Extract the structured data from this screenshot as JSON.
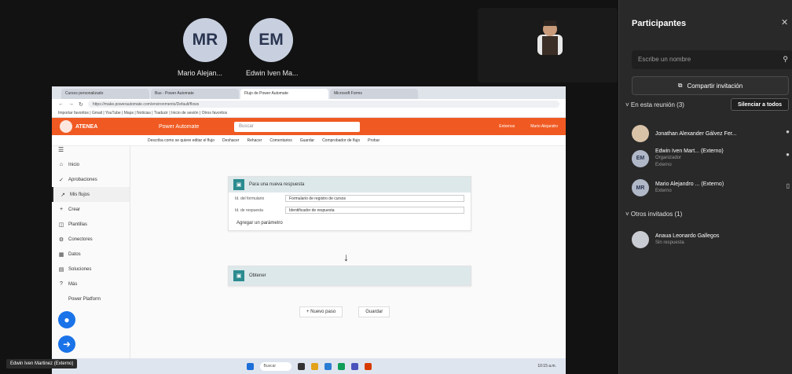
{
  "strip": {
    "tiles": [
      {
        "initials": "MR",
        "name": "Mario Alejan..."
      },
      {
        "initials": "EM",
        "name": "Edwin Iven Ma..."
      }
    ]
  },
  "browser": {
    "tabs": [
      "Cursos personalizado",
      "Bus - Power Automate",
      "Flujo de Power Automate",
      "Microsoft Forms"
    ],
    "url": "https://make.powerautomate.com/environments/Default/flows",
    "bookmarks": "Importar favoritos  |  Gmail  |  YouTube  |  Maps  |  Noticias  |  Traducir  |  Inicio de sesión  |  Otros favoritos"
  },
  "app": {
    "brand": "ATENEA",
    "header_title": "Power Automate",
    "search_placeholder": "Buscar",
    "env_label": "Entornos",
    "user_label": "Mario Alejandro",
    "cmdbar": [
      "Describa como se quiere editar el flujo",
      "Deshacer",
      "Rehacer",
      "Comentarios",
      "Guardar",
      "Comprobador de flujo",
      "Probar"
    ],
    "sidebar": [
      {
        "icon": "⌂",
        "label": "Inicio"
      },
      {
        "icon": "✓",
        "label": "Aprobaciones"
      },
      {
        "icon": "↗",
        "label": "Mis flujos"
      },
      {
        "icon": "+",
        "label": "Crear"
      },
      {
        "icon": "◫",
        "label": "Plantillas"
      },
      {
        "icon": "⚙",
        "label": "Conectores"
      },
      {
        "icon": "▦",
        "label": "Datos"
      },
      {
        "icon": "▤",
        "label": "Soluciones"
      },
      {
        "icon": "?",
        "label": "Más"
      },
      {
        "icon": "",
        "label": "Power Platform"
      }
    ],
    "card1": {
      "title": "Para una nueva respuesta",
      "fields": [
        {
          "label": "Id. del formulario",
          "value": "Formulario de registro de cursos"
        },
        {
          "label": "Id. de respuesta",
          "value": "Identificador de respuesta"
        }
      ],
      "add_param": "Agregar un parámetro"
    },
    "card2": {
      "title": "Obtener"
    },
    "buttons": {
      "new_step": "+ Nuevo paso",
      "save": "Guardar"
    },
    "presenter": "Edwin Iven Martinez (Externo)"
  },
  "taskbar": {
    "search": "Buscar",
    "time": "10:15 a.m."
  },
  "panel": {
    "title": "Participantes",
    "search_placeholder": "Escribe un nombre",
    "share_invite": "Compartir invitación",
    "in_meeting_label": "En esta reunión (3)",
    "admit_all": "Silenciar a todos",
    "in_meeting": [
      {
        "initials": "",
        "name": "Jonathan Alexander Gálvez Fer...",
        "role": ""
      },
      {
        "initials": "EM",
        "name": "Edwin Iven Mart... (Externo)",
        "role": "Organizador",
        "sub": "Externo"
      },
      {
        "initials": "MR",
        "name": "Mario Alejandro ... (Externo)",
        "role": "Externo"
      }
    ],
    "others_label": "Otros invitados (1)",
    "others": [
      {
        "initials": "",
        "name": "Anaua Leonardo Gallegos",
        "role": "Sin respuesta"
      }
    ]
  }
}
